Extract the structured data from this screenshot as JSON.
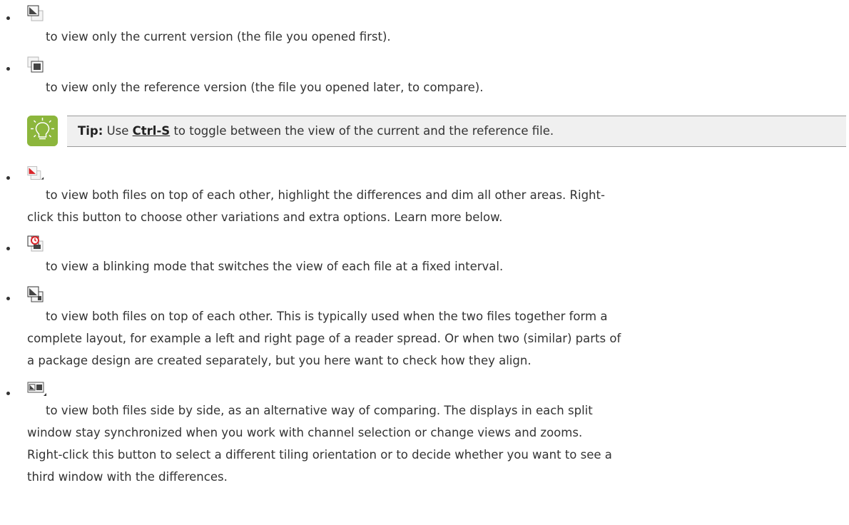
{
  "items": [
    {
      "icon": "view-current-version-icon",
      "text": "to view only the current version (the file you opened first)."
    },
    {
      "icon": "view-reference-version-icon",
      "text": "to view only the reference version (the file you opened later, to compare)."
    },
    {
      "icon": "highlight-differences-icon",
      "line1": "to view both files on top of each other, highlight the differences and dim all other areas. Right-",
      "line2": "click this button to choose other variations and extra options. Learn more below."
    },
    {
      "icon": "blink-mode-icon",
      "text": "to view a blinking mode that switches the view of each file at a fixed interval."
    },
    {
      "icon": "overlay-icon",
      "line1": "to view both files on top of each other. This is typically used when the two files together form a",
      "line2": "complete layout, for example a left and right page of a reader spread. Or when two (similar) parts of",
      "line3": "a package design are created separately, but you here want to check how they align."
    },
    {
      "icon": "side-by-side-icon",
      "line1": "to view both files side by side, as an alternative way of comparing. The displays in each split",
      "line2": "window stay synchronized when you work with channel selection or change views and zooms.",
      "line3": "Right-click this button to select a different tiling orientation or to decide whether you want to see a",
      "line4": "third window with the differences."
    }
  ],
  "tip": {
    "icon": "lightbulb-icon",
    "label": "Tip:",
    "before": "Use",
    "shortcut": "Ctrl-S",
    "after": "to toggle between the view of the current and the reference file."
  },
  "colors": {
    "text": "#333333",
    "tip_icon_bg": "#8cb63c",
    "tip_box_bg": "#f0f0f0",
    "highlight_red": "#d9252a"
  }
}
